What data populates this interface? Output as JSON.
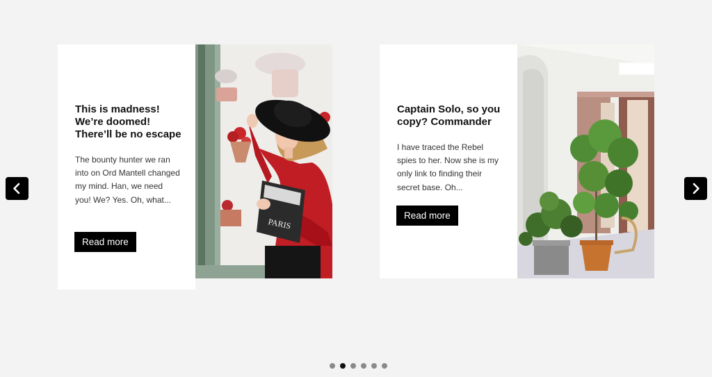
{
  "slides": [
    {
      "title": "This is madness! We’re doomed! There’ll be no escape",
      "text": "The bounty hunter we ran into on Ord Mantell changed my mind. Han, we need you! We? Yes. Oh, what...",
      "button_label": "Read more",
      "image": "woman-red-coat-black-hat-holding-magazine-photo"
    },
    {
      "title": "Captain Solo, so you copy? Commander",
      "text": "I have traced the Rebel spies to her. Now she is my only link to finding their secret base. Oh...",
      "button_label": "Read more",
      "image": "room-with-potted-plants-photo"
    }
  ],
  "navigation": {
    "prev_icon": "chevron-left-icon",
    "next_icon": "chevron-right-icon"
  },
  "pagination": {
    "total": 6,
    "active_index": 1
  },
  "colors": {
    "background": "#f3f3f3",
    "card": "#ffffff",
    "button": "#000000",
    "dot_active": "#111111",
    "dot_inactive": "#8a8a8a"
  }
}
